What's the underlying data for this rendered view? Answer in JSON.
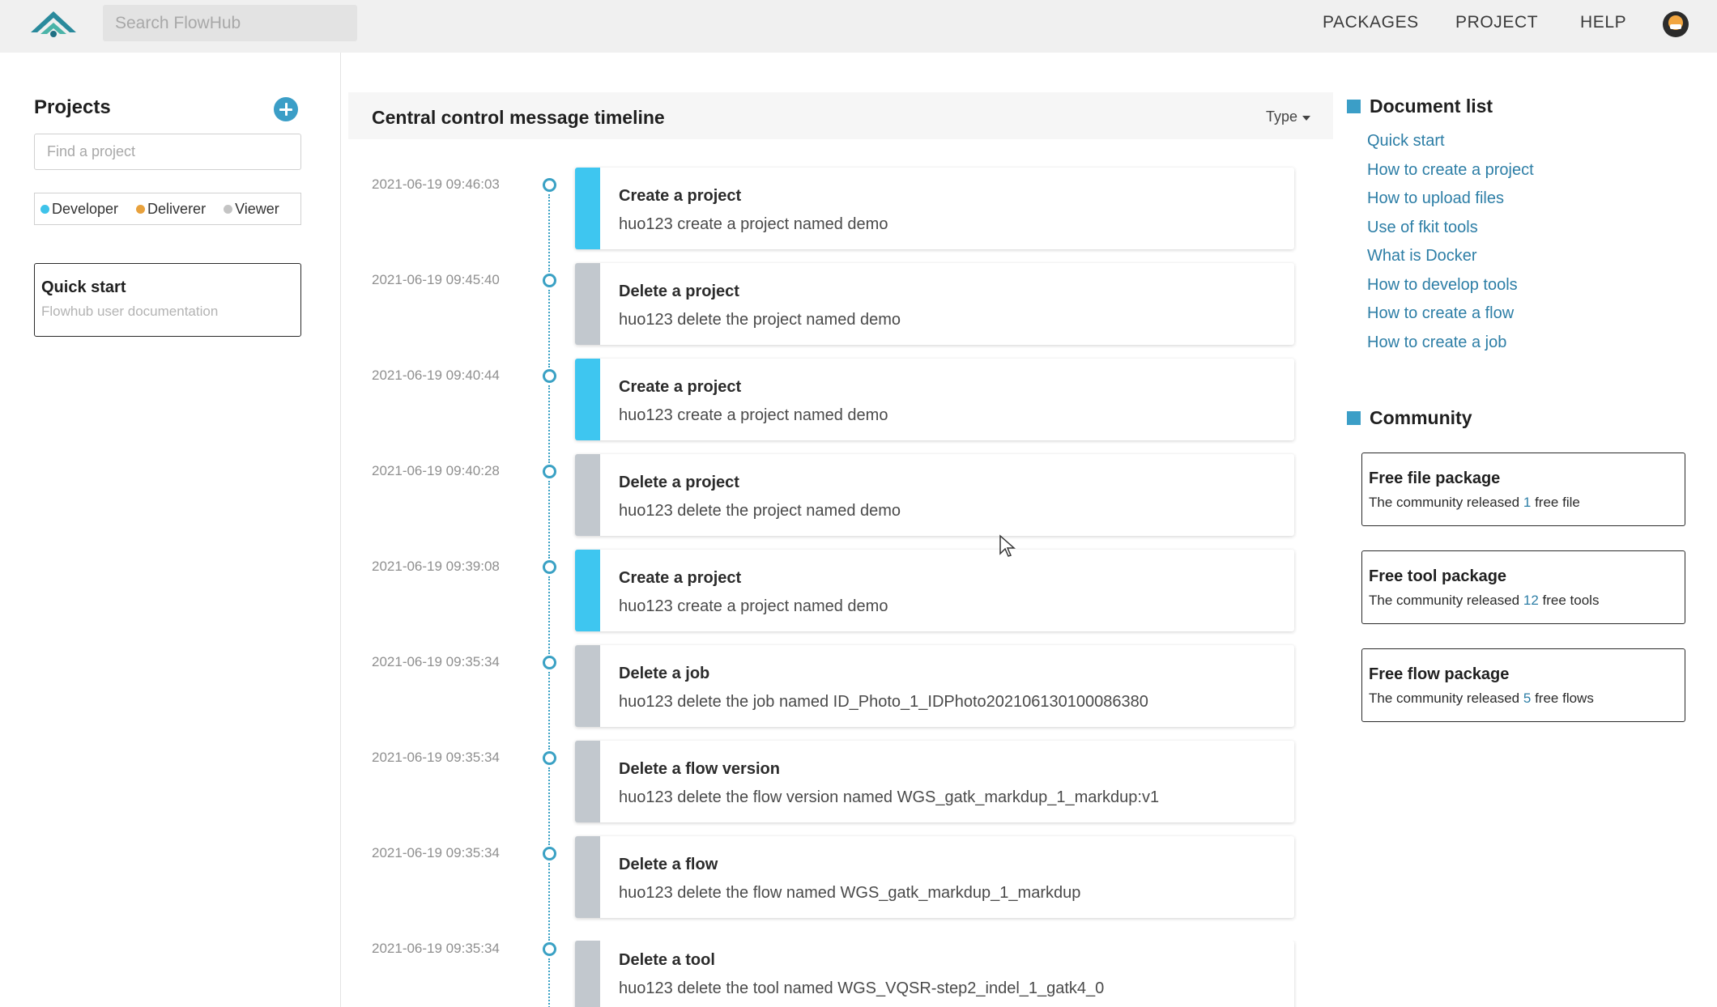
{
  "header": {
    "search_placeholder": "Search FlowHub",
    "nav": [
      "PACKAGES",
      "PROJECT",
      "HELP"
    ]
  },
  "sidebar": {
    "title": "Projects",
    "find_placeholder": "Find a project",
    "roles": [
      {
        "label": "Developer",
        "color": "#3ec3ea"
      },
      {
        "label": "Deliverer",
        "color": "#e8a13c"
      },
      {
        "label": "Viewer",
        "color": "#c4c4c4"
      }
    ],
    "quick_start": {
      "title": "Quick start",
      "subtitle": "Flowhub user documentation"
    }
  },
  "main": {
    "title": "Central control message timeline",
    "type_filter": "Type",
    "events": [
      {
        "time": "2021-06-19 09:46:03",
        "title": "Create a project",
        "desc": "huo123 create a project named demo",
        "accent": "#3ec6f0"
      },
      {
        "time": "2021-06-19 09:45:40",
        "title": "Delete a project",
        "desc": "huo123 delete the project named demo",
        "accent": "#c2c8ce"
      },
      {
        "time": "2021-06-19 09:40:44",
        "title": "Create a project",
        "desc": "huo123 create a project named demo",
        "accent": "#3ec6f0"
      },
      {
        "time": "2021-06-19 09:40:28",
        "title": "Delete a project",
        "desc": "huo123 delete the project named demo",
        "accent": "#c2c8ce"
      },
      {
        "time": "2021-06-19 09:39:08",
        "title": "Create a project",
        "desc": "huo123 create a project named demo",
        "accent": "#3ec6f0"
      },
      {
        "time": "2021-06-19 09:35:34",
        "title": "Delete a job",
        "desc": "huo123 delete the job named ID_Photo_1_IDPhoto202106130100086380",
        "accent": "#c2c8ce"
      },
      {
        "time": "2021-06-19 09:35:34",
        "title": "Delete a flow version",
        "desc": "huo123 delete the flow version named WGS_gatk_markdup_1_markdup:v1",
        "accent": "#c2c8ce"
      },
      {
        "time": "2021-06-19 09:35:34",
        "title": "Delete a flow",
        "desc": "huo123 delete the flow named WGS_gatk_markdup_1_markdup",
        "accent": "#c2c8ce"
      },
      {
        "time": "2021-06-19 09:35:34",
        "title": "Delete a tool",
        "desc": "huo123 delete the tool named WGS_VQSR-step2_indel_1_gatk4_0",
        "accent": "#c2c8ce"
      }
    ]
  },
  "right": {
    "doc_title": "Document list",
    "docs": [
      "Quick start",
      "How to create a project",
      "How to upload files",
      "Use of fkit tools",
      "What is Docker",
      "How to develop tools",
      "How to create a flow",
      "How to create a job"
    ],
    "community_title": "Community",
    "community": [
      {
        "title": "Free file package",
        "prefix": "The community released",
        "count": "1",
        "suffix": "free file"
      },
      {
        "title": "Free tool package",
        "prefix": "The community released",
        "count": "12",
        "suffix": "free tools"
      },
      {
        "title": "Free flow package",
        "prefix": "The community released",
        "count": "5",
        "suffix": "free flows"
      }
    ]
  }
}
